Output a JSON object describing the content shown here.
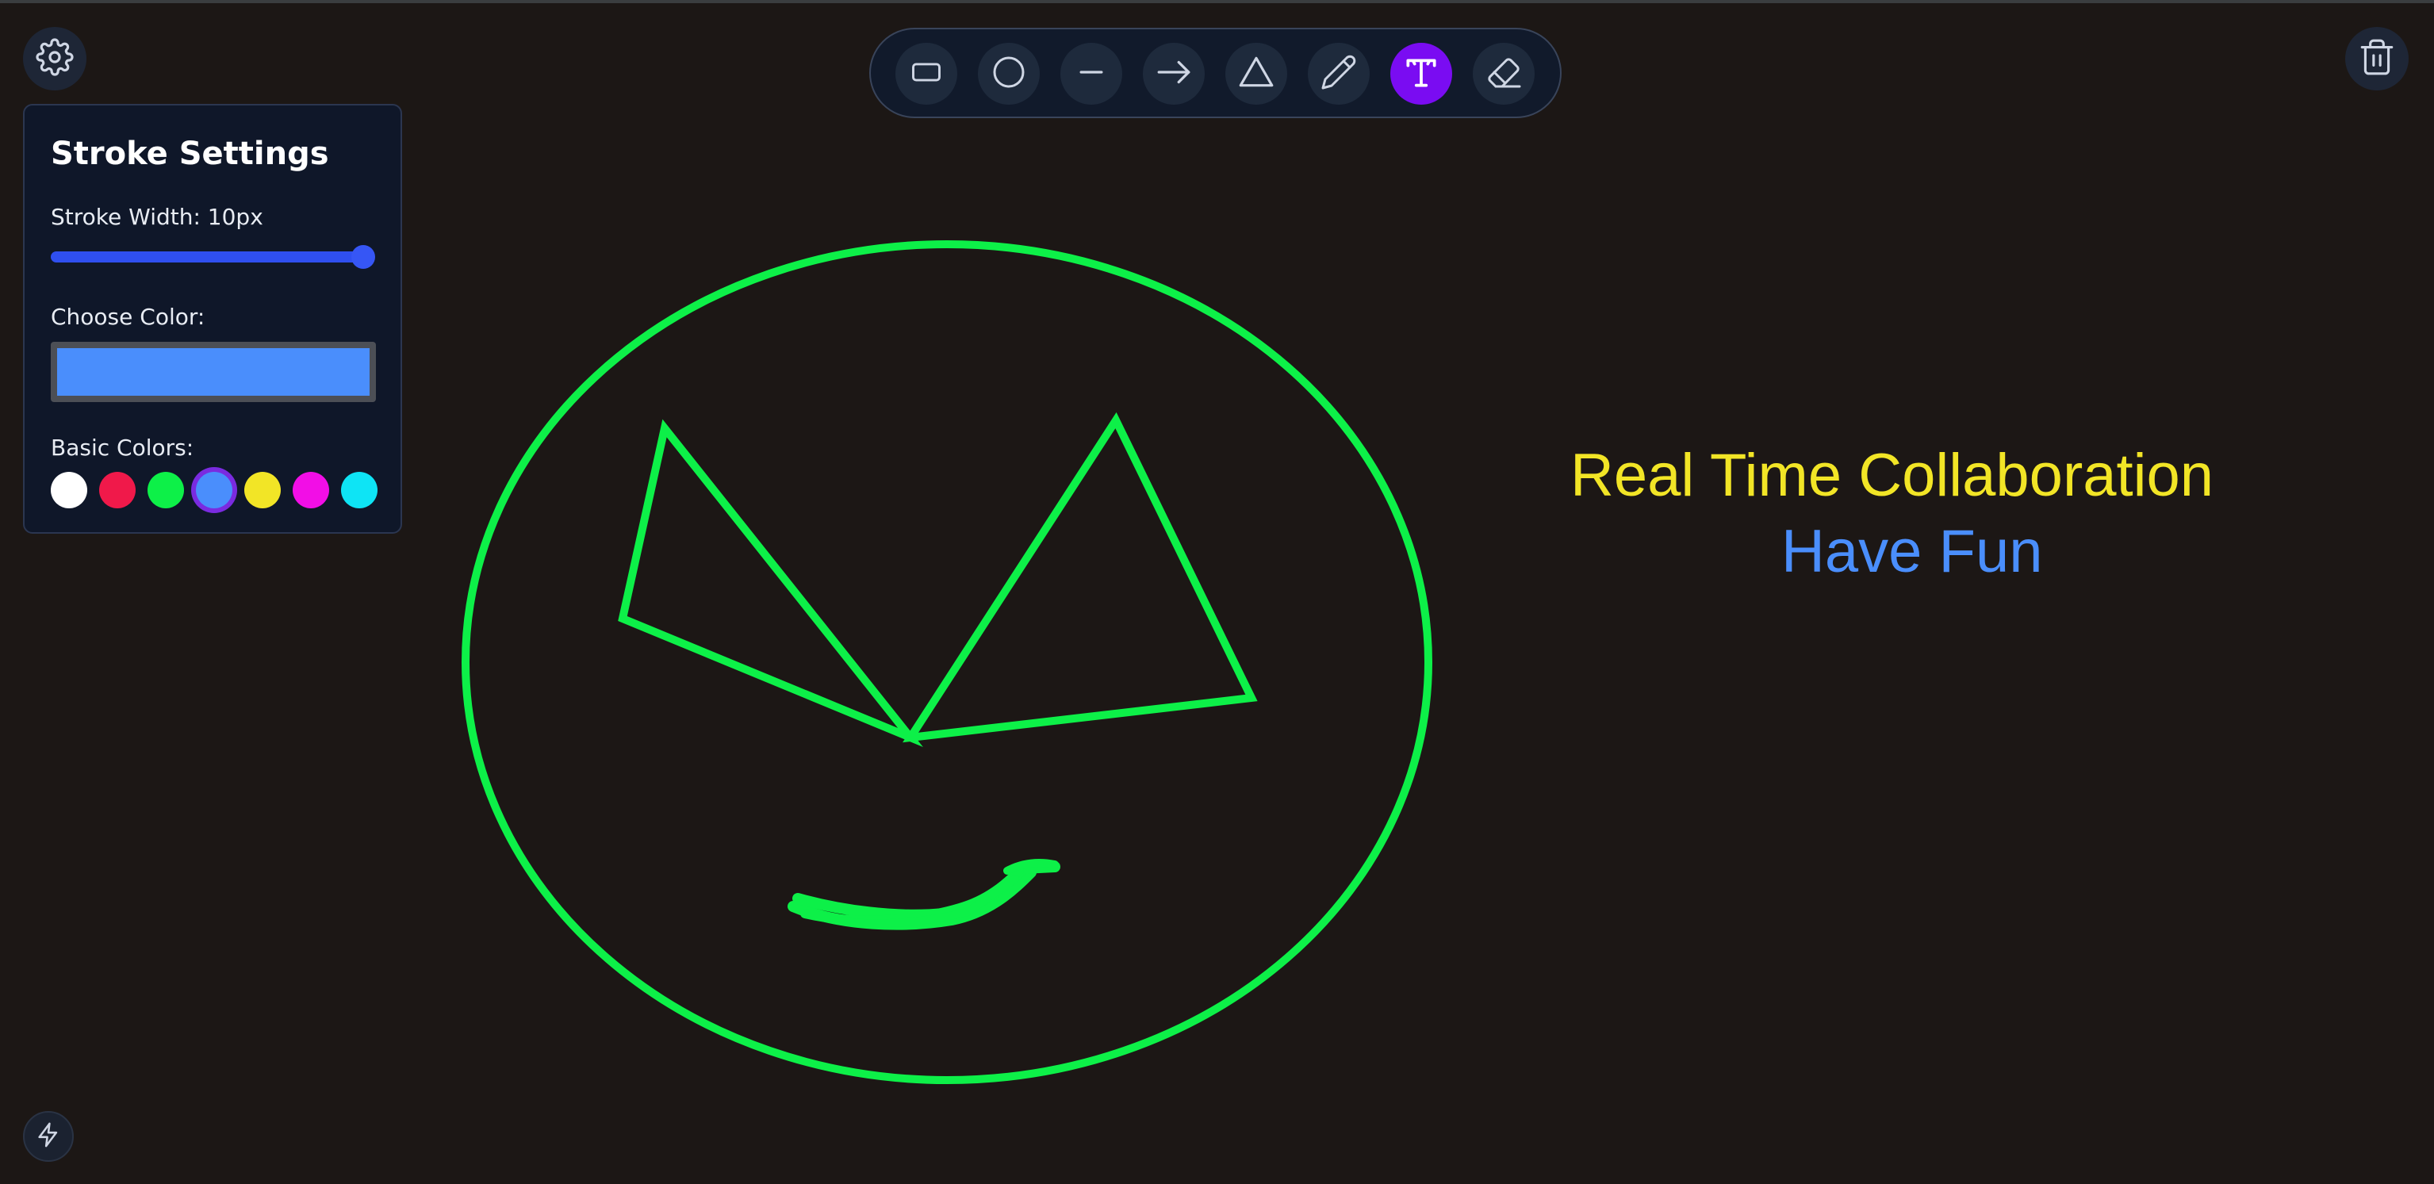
{
  "stroke_panel": {
    "title": "Stroke Settings",
    "stroke_width_label": "Stroke Width: 10px",
    "stroke_width_value": 10,
    "stroke_width_fraction": 1.0,
    "choose_color_label": "Choose Color:",
    "current_color": "#4a8efc",
    "basic_colors_label": "Basic Colors:",
    "basic_colors": [
      "#ffffff",
      "#f0194a",
      "#0df048",
      "#4a8efc",
      "#f2e526",
      "#f20ee6",
      "#0ee4f5"
    ],
    "selected_color": "#4a8efc"
  },
  "toolbar": {
    "tools": [
      {
        "name": "rectangle",
        "icon": "rectangle-icon",
        "active": false
      },
      {
        "name": "circle",
        "icon": "circle-icon",
        "active": false
      },
      {
        "name": "line",
        "icon": "line-icon",
        "active": false
      },
      {
        "name": "arrow",
        "icon": "arrow-icon",
        "active": false
      },
      {
        "name": "triangle",
        "icon": "triangle-icon",
        "active": false
      },
      {
        "name": "pencil",
        "icon": "pencil-icon",
        "active": false
      },
      {
        "name": "text",
        "icon": "text-icon",
        "active": true
      },
      {
        "name": "eraser",
        "icon": "eraser-icon",
        "active": false
      }
    ]
  },
  "canvas": {
    "stroke_color": "#0df048",
    "texts": [
      {
        "text": "Real Time Collaboration",
        "color": "#f2e526"
      },
      {
        "text": "Have Fun",
        "color": "#4a8efc"
      }
    ]
  },
  "icons": {
    "settings": "gear-icon",
    "trash": "trash-icon",
    "bolt": "bolt-icon"
  }
}
